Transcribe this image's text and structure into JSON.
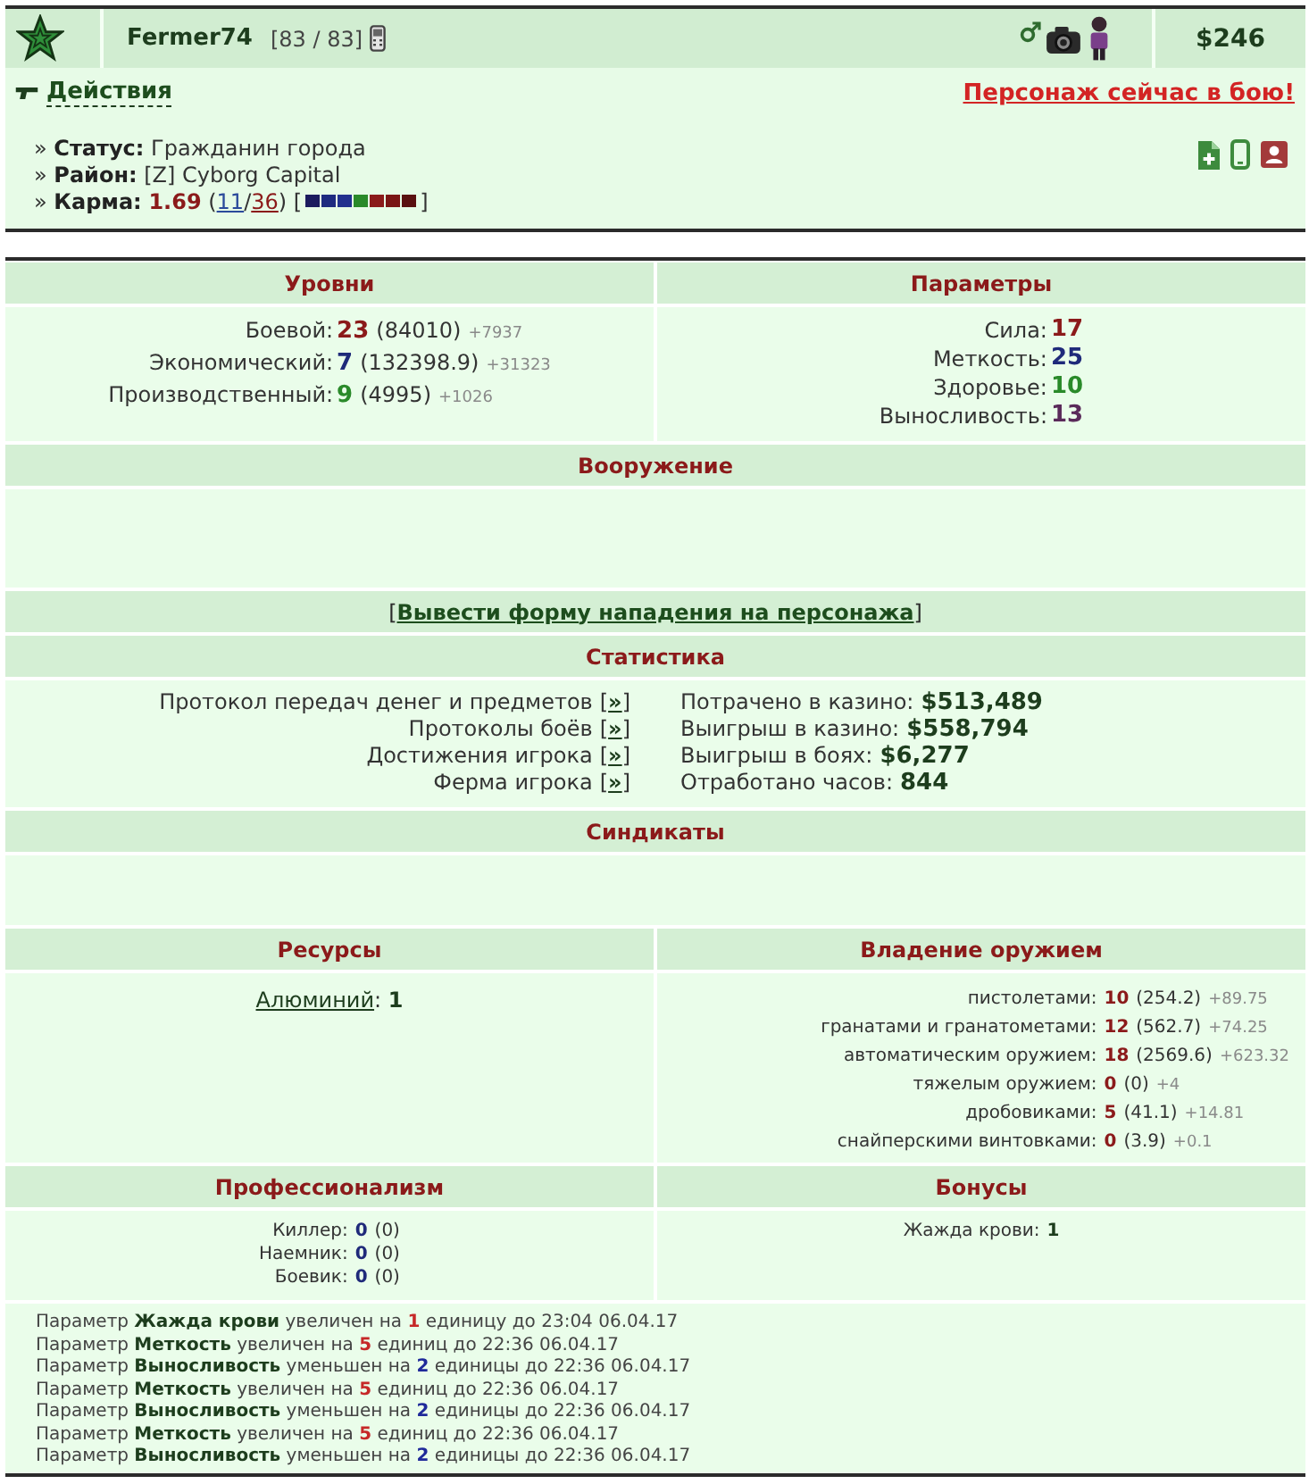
{
  "header": {
    "name": "Fermer74",
    "health": "[83 / 83]",
    "money": "$246"
  },
  "actions": {
    "label": "Действия",
    "battle_status": "Персонаж сейчас в бою!"
  },
  "info": [
    {
      "bullet": "»",
      "label": "Статус:",
      "value": "Гражданин города"
    },
    {
      "bullet": "»",
      "label": "Район:",
      "value": "[Z] Cyborg Capital"
    }
  ],
  "karma": {
    "bullet": "»",
    "label": "Карма:",
    "value": "1.69",
    "votes_open": "(",
    "votes": [
      {
        "text": "11",
        "color": "#2b4a9b"
      },
      {
        "text": "36",
        "color": "#8b1a1a"
      }
    ],
    "votes_sep": "/",
    "votes_close": ")",
    "bar_open": "[",
    "bar": [
      {
        "color": "#1b1b5e"
      },
      {
        "color": "#1e2a80"
      },
      {
        "color": "#22308e"
      },
      {
        "color": "#2a8a2a"
      },
      {
        "color": "#8b1a1a"
      },
      {
        "color": "#7a1515"
      },
      {
        "color": "#5a1010"
      }
    ],
    "bar_close": "]"
  },
  "levels": {
    "title": "Уровни",
    "rows": [
      {
        "label": "Боевой:",
        "value": "23",
        "color": "#8b1a1a",
        "total": "(84010)",
        "gain": "+7937"
      },
      {
        "label": "Экономический:",
        "value": "7",
        "color": "#1f2a7a",
        "total": "(132398.9)",
        "gain": "+31323"
      },
      {
        "label": "Производственный:",
        "value": "9",
        "color": "#2a8a2a",
        "total": "(4995)",
        "gain": "+1026"
      }
    ]
  },
  "params": {
    "title": "Параметры",
    "rows": [
      {
        "label": "Сила:",
        "value": "17",
        "color": "#8b1a1a"
      },
      {
        "label": "Меткость:",
        "value": "25",
        "color": "#1f2a7a"
      },
      {
        "label": "Здоровье:",
        "value": "10",
        "color": "#2a8a2a"
      },
      {
        "label": "Выносливость:",
        "value": "13",
        "color": "#5a2a5a"
      }
    ]
  },
  "armament": {
    "title": "Вооружение"
  },
  "attack": {
    "open": "[",
    "link": "Вывести форму нападения на персонажа",
    "close": "]"
  },
  "statistics": {
    "title": "Статистика",
    "links": [
      {
        "label": "Протокол передач денег и предметов",
        "open": "[",
        "link": "»",
        "close": "]"
      },
      {
        "label": "Протоколы боёв",
        "open": "[",
        "link": "»",
        "close": "]"
      },
      {
        "label": "Достижения игрока",
        "open": "[",
        "link": "»",
        "close": "]"
      },
      {
        "label": "Ферма игрока",
        "open": "[",
        "link": "»",
        "close": "]"
      }
    ],
    "totals": [
      {
        "label": "Потрачено в казино:",
        "value": "$513,489"
      },
      {
        "label": "Выигрыш в казино:",
        "value": "$558,794"
      },
      {
        "label": "Выигрыш в боях:",
        "value": "$6,277"
      },
      {
        "label": "Отработано часов:",
        "value": "844"
      }
    ]
  },
  "syndicates": {
    "title": "Синдикаты"
  },
  "resources": {
    "title": "Ресурсы",
    "items": [
      {
        "name": "Алюминий",
        "colon": ":",
        "amount": "1"
      }
    ]
  },
  "weapon_skills": {
    "title": "Владение оружием",
    "rows": [
      {
        "label": "пистолетами:",
        "value": "10",
        "total": "(254.2)",
        "gain": "+89.75"
      },
      {
        "label": "гранатами и гранатометами:",
        "value": "12",
        "total": "(562.7)",
        "gain": "+74.25"
      },
      {
        "label": "автоматическим оружием:",
        "value": "18",
        "total": "(2569.6)",
        "gain": "+623.32"
      },
      {
        "label": "тяжелым оружием:",
        "value": "0",
        "total": "(0)",
        "gain": "+4"
      },
      {
        "label": "дробовиками:",
        "value": "5",
        "total": "(41.1)",
        "gain": "+14.81"
      },
      {
        "label": "снайперскими винтовками:",
        "value": "0",
        "total": "(3.9)",
        "gain": "+0.1"
      }
    ]
  },
  "professionalism": {
    "title": "Профессионализм",
    "rows": [
      {
        "label": "Киллер:",
        "value": "0",
        "total": "(0)"
      },
      {
        "label": "Наемник:",
        "value": "0",
        "total": "(0)"
      },
      {
        "label": "Боевик:",
        "value": "0",
        "total": "(0)"
      }
    ]
  },
  "bonuses": {
    "title": "Бонусы",
    "rows": [
      {
        "label": "Жажда крови:",
        "value": "1"
      }
    ]
  },
  "log": [
    {
      "kind": "increase",
      "prefix": "Параметр",
      "param": "Жажда крови",
      "verb": "увеличен на",
      "amount": "1",
      "suffix": "единицу до 23:04 06.04.17"
    },
    {
      "kind": "increase",
      "prefix": "Параметр",
      "param": "Меткость",
      "verb": "увеличен на",
      "amount": "5",
      "suffix": "единиц до 22:36 06.04.17"
    },
    {
      "kind": "decrease",
      "prefix": "Параметр",
      "param": "Выносливость",
      "verb": "уменьшен на",
      "amount": "2",
      "suffix": "единицы до 22:36 06.04.17"
    },
    {
      "kind": "increase",
      "prefix": "Параметр",
      "param": "Меткость",
      "verb": "увеличен на",
      "amount": "5",
      "suffix": "единиц до 22:36 06.04.17"
    },
    {
      "kind": "decrease",
      "prefix": "Параметр",
      "param": "Выносливость",
      "verb": "уменьшен на",
      "amount": "2",
      "suffix": "единицы до 22:36 06.04.17"
    },
    {
      "kind": "increase",
      "prefix": "Параметр",
      "param": "Меткость",
      "verb": "увеличен на",
      "amount": "5",
      "suffix": "единиц до 22:36 06.04.17"
    },
    {
      "kind": "decrease",
      "prefix": "Параметр",
      "param": "Выносливость",
      "verb": "уменьшен на",
      "amount": "2",
      "suffix": "единицы до 22:36 06.04.17"
    }
  ]
}
